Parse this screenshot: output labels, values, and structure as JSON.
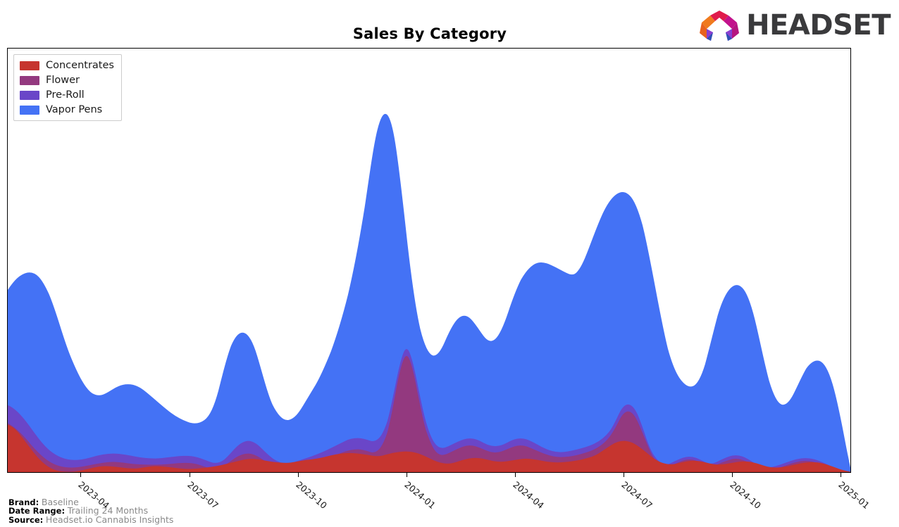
{
  "header": {
    "title": "Sales By Category",
    "logo_text": "HEADSET",
    "logo_mark_name": "headset-ring-logo"
  },
  "legend": {
    "position": "top-left",
    "items": [
      {
        "label": "Concentrates",
        "color": "#c6352f"
      },
      {
        "label": "Flower",
        "color": "#93397f"
      },
      {
        "label": "Pre-Roll",
        "color": "#6a46c8"
      },
      {
        "label": "Vapor Pens",
        "color": "#4472f5"
      }
    ]
  },
  "footer": {
    "brand_key": "Brand:",
    "brand_value": "Baseline",
    "date_range_key": "Date Range:",
    "date_range_value": "Trailing 24 Months",
    "source_key": "Source:",
    "source_value": "Headset.io Cannabis Insights"
  },
  "axis": {
    "x_ticks": [
      "2023-04",
      "2023-07",
      "2023-10",
      "2024-01",
      "2024-04",
      "2024-07",
      "2024-10",
      "2025-01"
    ],
    "x_tick_positions": [
      0.0872,
      0.2158,
      0.3444,
      0.473,
      0.6016,
      0.7302,
      0.8588,
      0.9874
    ],
    "y_axis_labels": [],
    "grid": false
  },
  "chart_data": {
    "type": "area",
    "stacked": true,
    "title": "Sales By Category",
    "xlabel": "",
    "ylabel": "",
    "grid": false,
    "legend_position": "top-left",
    "x": [
      "2023-01",
      "2023-02",
      "2023-03",
      "2023-04",
      "2023-05",
      "2023-06",
      "2023-07",
      "2023-08",
      "2023-09",
      "2023-10",
      "2023-11",
      "2023-12",
      "2024-01",
      "2024-02",
      "2024-03",
      "2024-04",
      "2024-05",
      "2024-06",
      "2024-07",
      "2024-08",
      "2024-09",
      "2024-10",
      "2024-11",
      "2024-12",
      "2025-01"
    ],
    "ylim": [
      0,
      100
    ],
    "series": [
      {
        "name": "Concentrates",
        "color": "#c6352f",
        "values": [
          11.5,
          8.0,
          3.0,
          2.5,
          4.0,
          4.5,
          3.5,
          7.0,
          5.0,
          7.5,
          11.0,
          12.0,
          7.0,
          11.5,
          9.0,
          14.5,
          13.0,
          15.0,
          17.5,
          11.5,
          10.5,
          13.0,
          9.5,
          12.5,
          11.5
        ]
      },
      {
        "name": "Flower",
        "color": "#93397f",
        "values": [
          13.5,
          6.5,
          1.0,
          1.2,
          1.5,
          1.2,
          1.0,
          3.0,
          1.5,
          2.5,
          19.5,
          7.5,
          1.5,
          5.5,
          3.0,
          4.5,
          3.5,
          10.0,
          2.0,
          1.5,
          12.0,
          2.0,
          1.0,
          1.5,
          0.6
        ]
      },
      {
        "name": "Pre-Roll",
        "color": "#6a46c8",
        "values": [
          5.0,
          3.0,
          1.2,
          1.0,
          1.5,
          1.0,
          1.0,
          2.0,
          1.5,
          2.0,
          4.5,
          3.0,
          1.5,
          2.5,
          2.0,
          3.0,
          2.5,
          3.0,
          1.5,
          1.2,
          1.5,
          1.2,
          0.8,
          1.0,
          0.5
        ]
      },
      {
        "name": "Vapor Pens",
        "color": "#4472f5",
        "values": [
          43.0,
          30.0,
          12.0,
          16.0,
          9.0,
          4.5,
          26.5,
          10.5,
          15.0,
          43.0,
          60.5,
          22.0,
          22.0,
          28.0,
          39.0,
          47.0,
          44.0,
          57.5,
          24.5,
          21.5,
          28.5,
          12.0,
          22.0,
          28.0,
          3.0
        ]
      }
    ],
    "peak_note": "Maximum stacked total occurs at 2023-11 (~95); secondary peak at 2024-06 (~85)."
  }
}
